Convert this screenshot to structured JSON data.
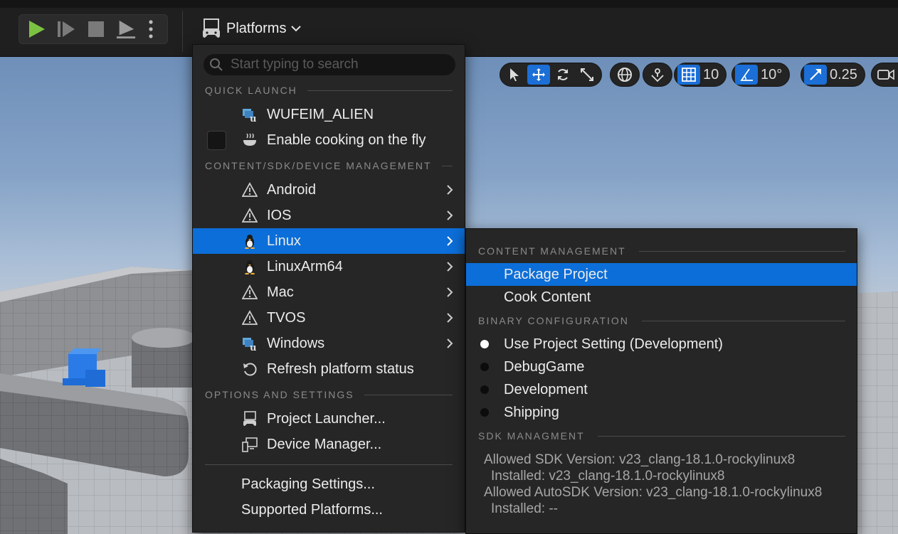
{
  "toolbar": {
    "platforms_label": "Platforms"
  },
  "viewport": {
    "grid_snap_value": "10",
    "rotation_snap_value": "10°",
    "scale_snap_value": "0.25"
  },
  "menu": {
    "search_placeholder": "Start typing to search",
    "quick_launch_header": "QUICK LAUNCH",
    "quick_launch_items": [
      {
        "label": "WUFEIM_ALIEN",
        "icon": "unreal-device-icon"
      },
      {
        "label": "Enable cooking on the fly",
        "icon": "cooking-pot-icon",
        "checked": false
      }
    ],
    "content_header": "CONTENT/SDK/DEVICE MANAGEMENT",
    "platforms": [
      {
        "label": "Android",
        "icon": "warning-icon"
      },
      {
        "label": "IOS",
        "icon": "warning-icon"
      },
      {
        "label": "Linux",
        "icon": "linux-penguin-icon",
        "highlighted": true
      },
      {
        "label": "LinuxArm64",
        "icon": "linux-penguin-icon"
      },
      {
        "label": "Mac",
        "icon": "warning-icon"
      },
      {
        "label": "TVOS",
        "icon": "warning-icon"
      },
      {
        "label": "Windows",
        "icon": "unreal-device-icon"
      }
    ],
    "refresh_label": "Refresh platform status",
    "options_header": "OPTIONS AND SETTINGS",
    "project_launcher_label": "Project Launcher...",
    "device_manager_label": "Device Manager...",
    "packaging_settings_label": "Packaging Settings...",
    "supported_platforms_label": "Supported Platforms..."
  },
  "submenu": {
    "content_management_header": "CONTENT MANAGEMENT",
    "package_project_label": "Package Project",
    "cook_content_label": "Cook Content",
    "binary_config_header": "BINARY CONFIGURATION",
    "binary_configs": [
      {
        "label": "Use Project Setting (Development)",
        "selected": true
      },
      {
        "label": "DebugGame",
        "selected": false
      },
      {
        "label": "Development",
        "selected": false
      },
      {
        "label": "Shipping",
        "selected": false
      }
    ],
    "sdk_header": "SDK MANAGMENT",
    "sdk_lines": {
      "allowed_sdk": "Allowed SDK Version: v23_clang-18.1.0-rockylinux8",
      "installed_sdk": "Installed: v23_clang-18.1.0-rockylinux8",
      "allowed_autosdk": "Allowed AutoSDK Version: v23_clang-18.1.0-rockylinux8",
      "installed_autosdk": "Installed: --"
    }
  },
  "colors": {
    "highlight": "#0c6ed8",
    "play_green": "#7cc242",
    "menu_bg": "#262626"
  }
}
